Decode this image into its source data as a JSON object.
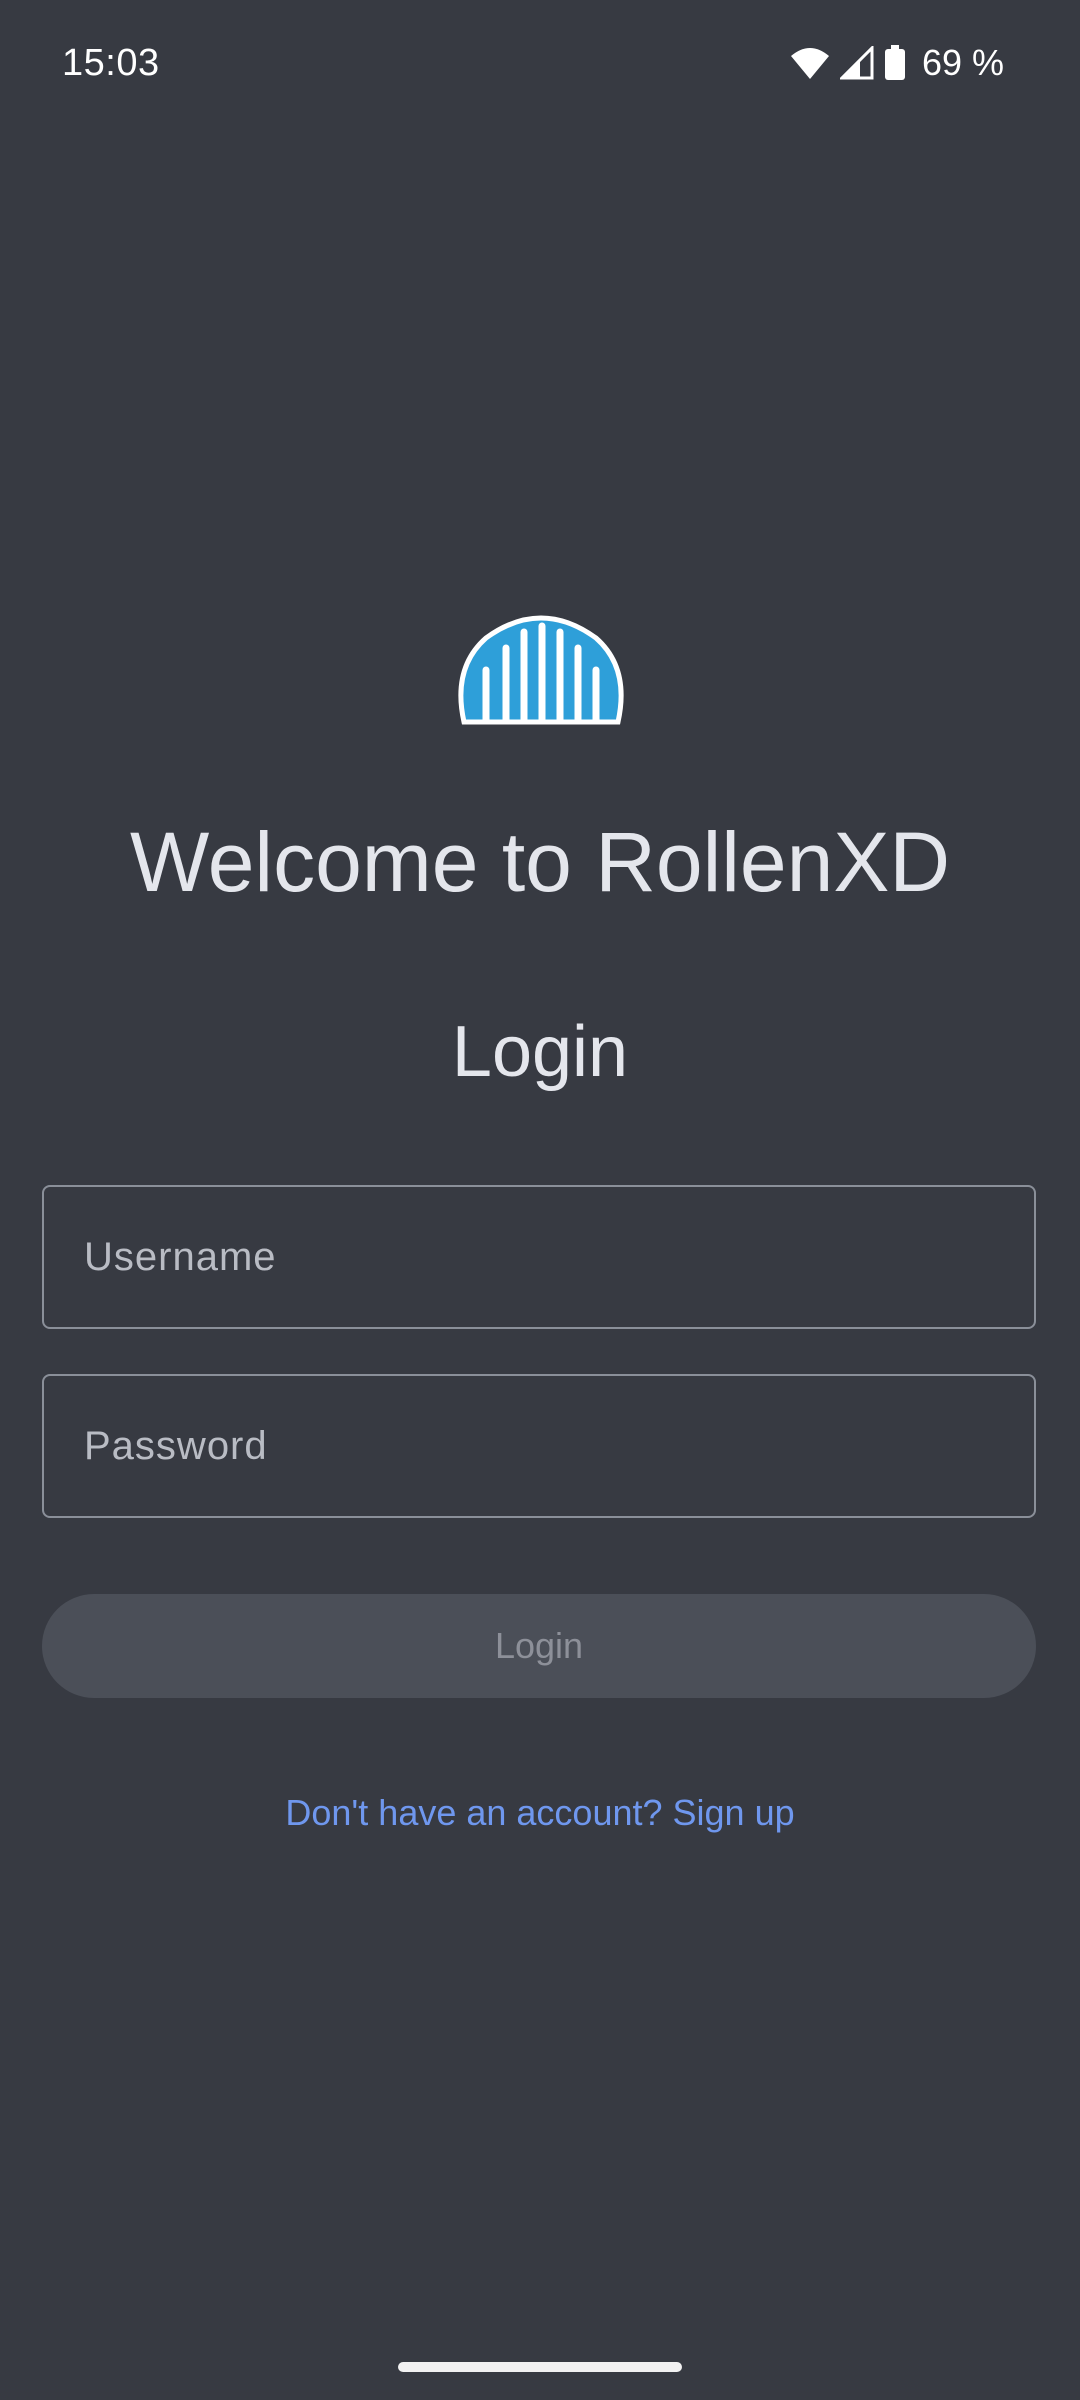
{
  "status_bar": {
    "time": "15:03",
    "battery_text": "69 %",
    "icons": [
      "wifi-icon",
      "signal-icon",
      "battery-icon"
    ]
  },
  "app": {
    "logo_icon": "rollenxd-logo-icon",
    "welcome_title": "Welcome to RollenXD",
    "login_heading": "Login"
  },
  "form": {
    "username_placeholder": "Username",
    "username_value": "",
    "password_placeholder": "Password",
    "password_value": "",
    "login_button_label": "Login",
    "signup_link_text": "Don't have an account? Sign up"
  },
  "colors": {
    "background": "#373a42",
    "text": "#e4e6ec",
    "link": "#6f97ee",
    "logo_blue": "#2e9fd9",
    "button_disabled_bg": "#4b4f58"
  }
}
